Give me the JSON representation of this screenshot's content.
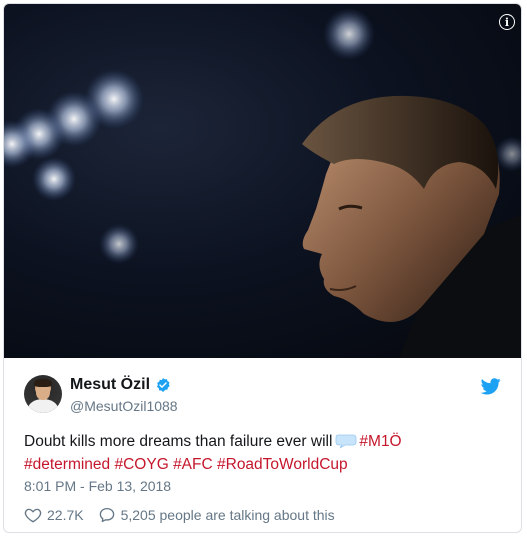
{
  "tweet": {
    "author_name": "Mesut Özil",
    "author_handle": "@MesutOzil1088",
    "text_plain": "Doubt kills more dreams than failure ever will",
    "emoji": "speech-bubble-emoji",
    "hashtags_line1": [
      "#M1Ö"
    ],
    "hashtags_line2": [
      "#determined",
      "#COYG",
      "#AFC",
      "#RoadToWorldCup"
    ],
    "timestamp": "8:01 PM - Feb 13, 2018",
    "likes": "22.7K",
    "talking": "5,205 people are talking about this"
  },
  "icons": {
    "info": "info-icon",
    "verified": "verified-badge-icon",
    "twitter": "twitter-bird-icon",
    "heart": "heart-icon",
    "comment": "comment-icon"
  },
  "info_glyph": "i",
  "colors": {
    "hashtag": "#c5172c",
    "verified": "#1da1f2",
    "twitter_blue": "#1da1f2",
    "muted": "#657786",
    "text": "#14171a"
  }
}
